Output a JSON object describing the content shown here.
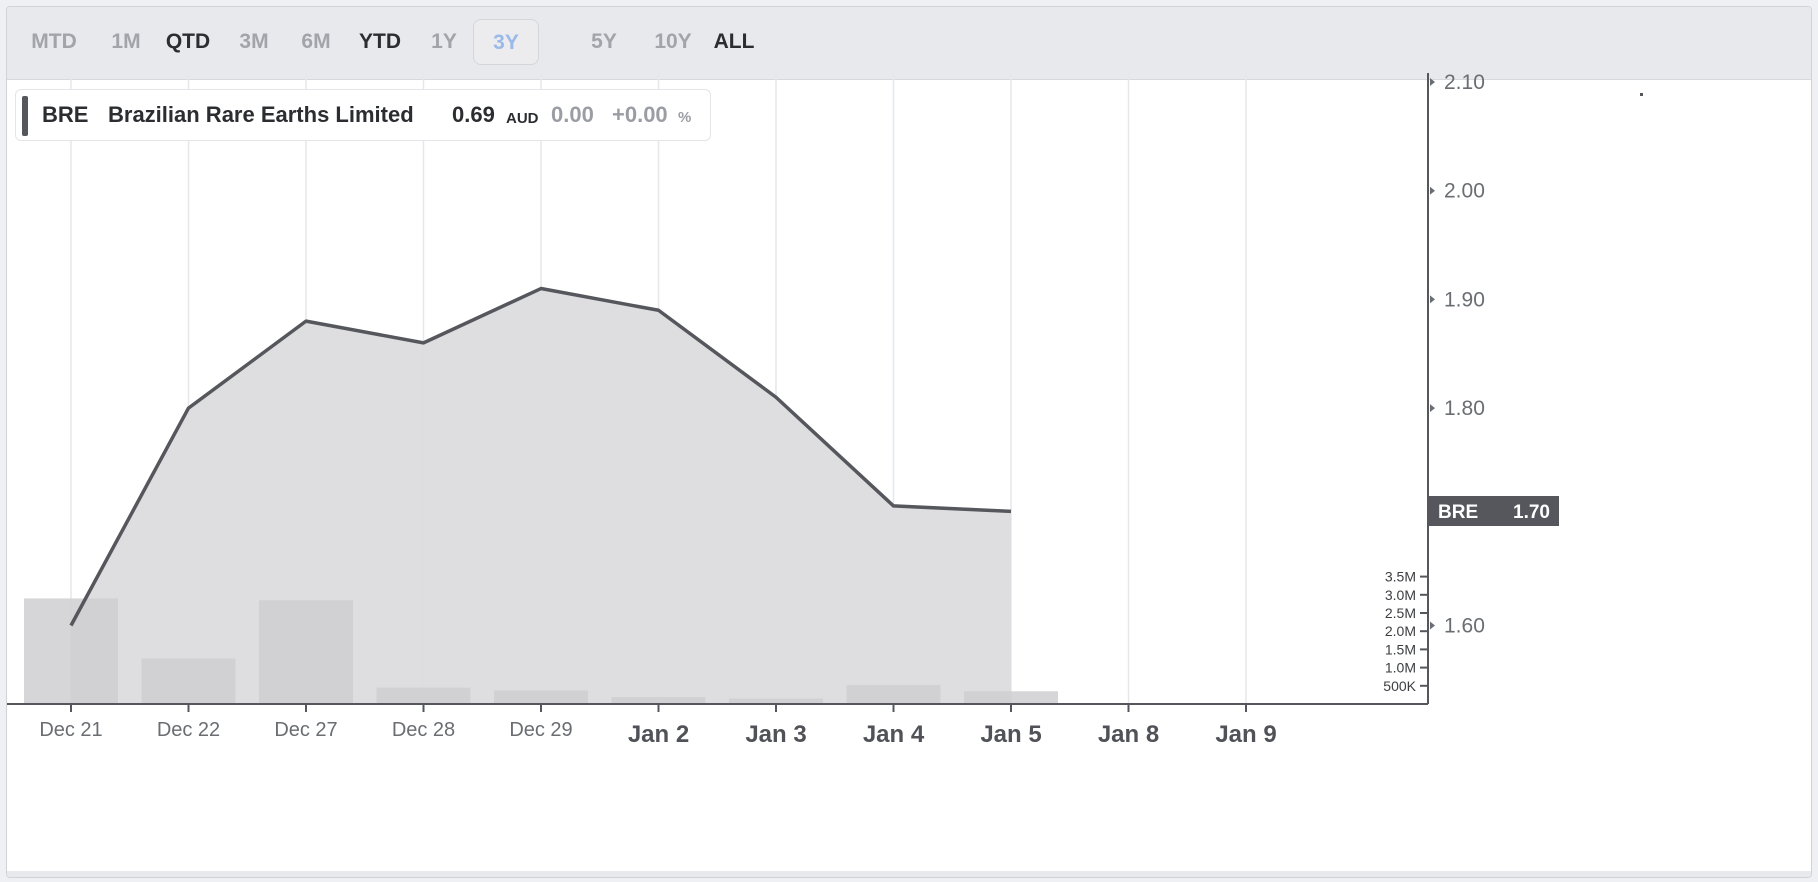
{
  "toolbar": {
    "tabs": [
      {
        "label": "MTD",
        "state": "inactive"
      },
      {
        "label": "1M",
        "state": "inactive"
      },
      {
        "label": "QTD",
        "state": "dark"
      },
      {
        "label": "3M",
        "state": "inactive"
      },
      {
        "label": "6M",
        "state": "inactive"
      },
      {
        "label": "YTD",
        "state": "dark"
      },
      {
        "label": "1Y",
        "state": "inactive"
      },
      {
        "label": "3Y",
        "state": "active"
      },
      {
        "label": "5Y",
        "state": "inactive"
      },
      {
        "label": "10Y",
        "state": "inactive"
      },
      {
        "label": "ALL",
        "state": "dark"
      }
    ]
  },
  "legend": {
    "ticker": "BRE",
    "name": "Brazilian Rare Earths Limited",
    "price": "0.69",
    "currency": "AUD",
    "change": "0.00",
    "change_pct": "+0.00",
    "pct_sign": "%"
  },
  "price_label": {
    "ticker": "BRE",
    "value": "1.70"
  },
  "colors": {
    "line": "#55575d",
    "area": "#dcdcde",
    "volume": "#cfcfd1",
    "label_bg": "#55575d",
    "grid": "#e6e7e9",
    "active_tab": "#9bb9e8"
  },
  "chart_data": {
    "type": "line",
    "categories": [
      "Dec 21",
      "Dec 22",
      "Dec 27",
      "Dec 28",
      "Dec 29",
      "Jan 2",
      "Jan 3",
      "Jan 4",
      "Jan 5",
      "Jan 8",
      "Jan 9"
    ],
    "series": [
      {
        "values": [
          1.6,
          1.8,
          1.88,
          1.86,
          1.91,
          1.89,
          1.81,
          1.71,
          1.705
        ]
      }
    ],
    "volume": [
      2900000,
      1250000,
      2850000,
      450000,
      370000,
      190000,
      150000,
      520000,
      350000
    ],
    "ylim": [
      1.52,
      2.11
    ],
    "y_ticks": [
      "2.10",
      "2.00",
      "1.90",
      "1.80",
      "1.60"
    ],
    "volume_ticks": [
      "3.5M",
      "3.0M",
      "2.5M",
      "2.0M",
      "1.5M",
      "1.0M",
      "500K"
    ],
    "volume_tick_values": [
      3500000,
      3000000,
      2500000,
      2000000,
      1500000,
      1000000,
      500000
    ],
    "grid": true,
    "y_axis_position": "right"
  }
}
